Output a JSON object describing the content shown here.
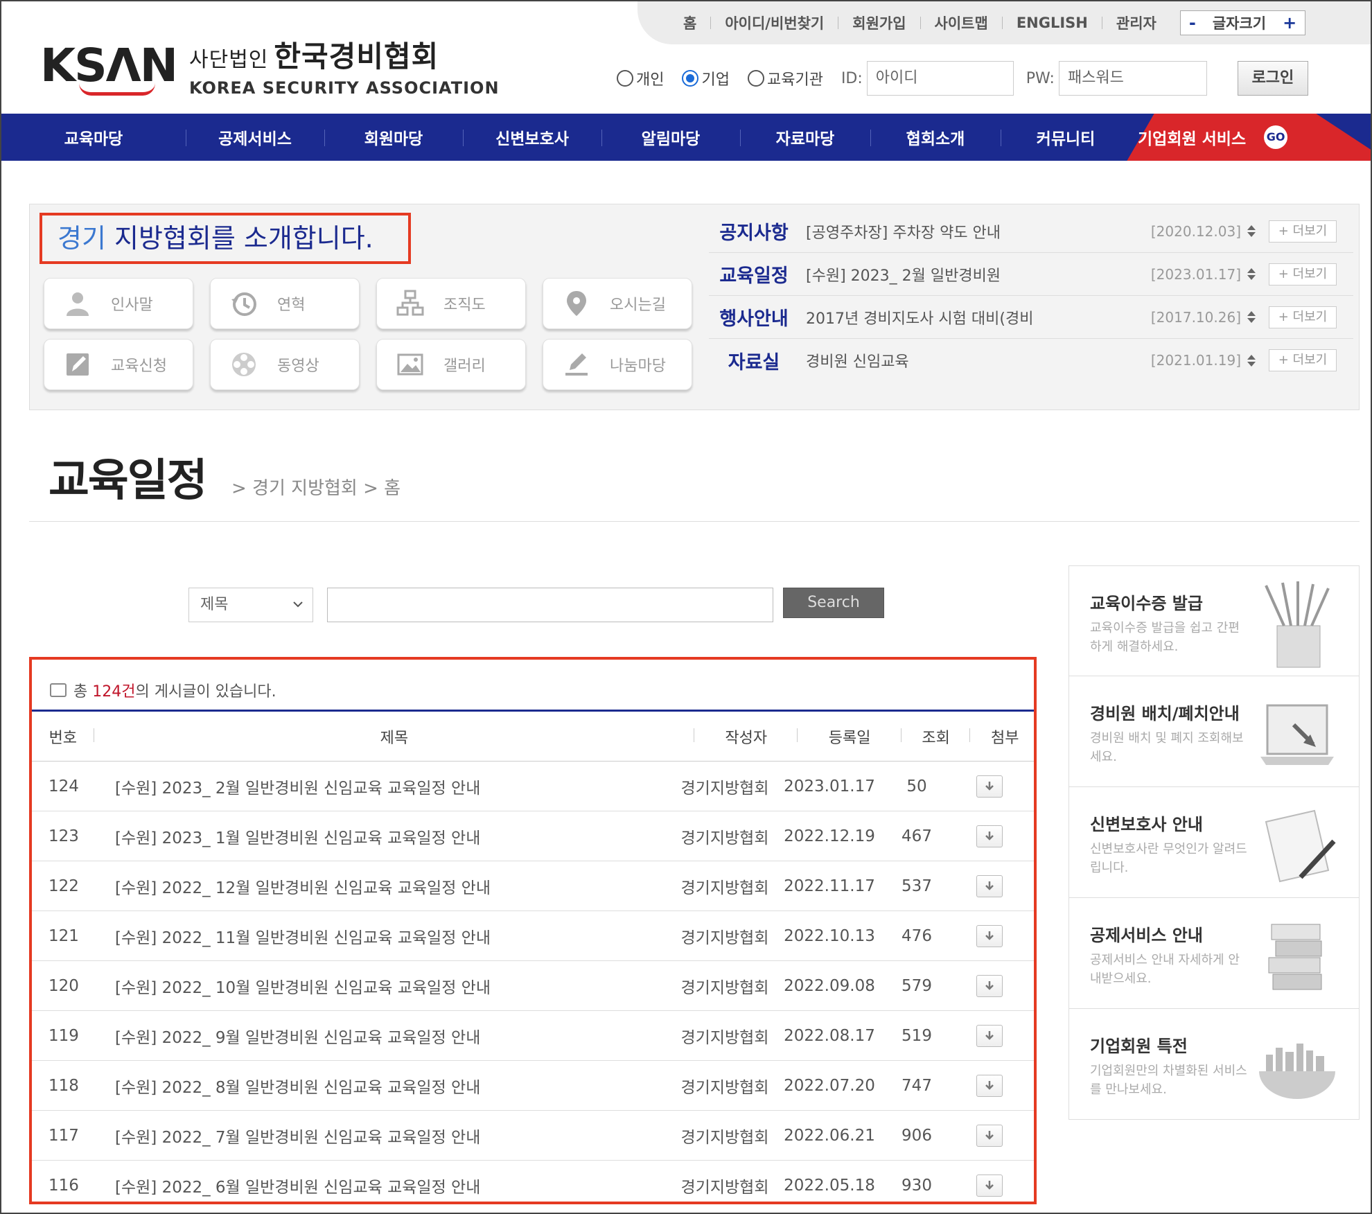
{
  "header": {
    "logo_mark": "KSΛN",
    "logo_kr_small": "사단법인",
    "logo_kr": "한국경비협회",
    "logo_en": "KOREA SECURITY ASSOCIATION"
  },
  "util_links": [
    "홈",
    "아이디/비번찾기",
    "회원가입",
    "사이트맵",
    "ENGLISH",
    "관리자"
  ],
  "font_size": {
    "minus": "-",
    "label": "글자크기",
    "plus": "+"
  },
  "login": {
    "radios": [
      {
        "label": "개인",
        "checked": false
      },
      {
        "label": "기업",
        "checked": true
      },
      {
        "label": "교육기관",
        "checked": false
      }
    ],
    "id_label": "ID:",
    "id_placeholder": "아이디",
    "pw_label": "PW:",
    "pw_placeholder": "패스워드",
    "button": "로그인"
  },
  "nav": {
    "items": [
      "교육마당",
      "공제서비스",
      "회원마당",
      "신변보호사",
      "알림마당",
      "자료마당",
      "협회소개",
      "커뮤니티"
    ],
    "corp_label": "기업회원 서비스",
    "go_label": "GO"
  },
  "intro": {
    "title_accent": "경기",
    "title_rest": " 지방협회를 소개합니다.",
    "tiles": [
      {
        "label": "인사말",
        "icon": "person-icon"
      },
      {
        "label": "연혁",
        "icon": "history-icon"
      },
      {
        "label": "조직도",
        "icon": "org-chart-icon"
      },
      {
        "label": "오시는길",
        "icon": "location-pin-icon"
      },
      {
        "label": "교육신청",
        "icon": "edit-note-icon"
      },
      {
        "label": "동영상",
        "icon": "film-reel-icon"
      },
      {
        "label": "갤러리",
        "icon": "image-icon"
      },
      {
        "label": "나눔마당",
        "icon": "pen-write-icon"
      }
    ]
  },
  "notices": [
    {
      "category": "공지사항",
      "title": "[공영주차장] 주차장 약도 안내",
      "date": "[2020.12.03]",
      "more": "+ 더보기"
    },
    {
      "category": "교육일정",
      "title": "[수원] 2023_ 2월 일반경비원",
      "date": "[2023.01.17]",
      "more": "+ 더보기"
    },
    {
      "category": "행사안내",
      "title": "2017년 경비지도사 시험 대비(경비",
      "date": "[2017.10.26]",
      "more": "+ 더보기"
    },
    {
      "category": "자료실",
      "title": "경비원 신임교육",
      "date": "[2021.01.19]",
      "more": "+ 더보기"
    }
  ],
  "page": {
    "title": "교육일정",
    "breadcrumb": "> 경기 지방협회 > 홈"
  },
  "search": {
    "select_value": "제목",
    "button": "Search"
  },
  "board": {
    "count_prefix": "총 ",
    "count_value": "124건",
    "count_suffix": "의 게시글이 있습니다.",
    "columns": [
      "번호",
      "제목",
      "작성자",
      "등록일",
      "조회",
      "첨부"
    ],
    "rows": [
      {
        "no": "124",
        "title": "[수원] 2023_ 2월 일반경비원 신임교육 교육일정 안내",
        "writer": "경기지방협회",
        "date": "2023.01.17",
        "views": "50"
      },
      {
        "no": "123",
        "title": "[수원] 2023_ 1월 일반경비원 신임교육 교육일정 안내",
        "writer": "경기지방협회",
        "date": "2022.12.19",
        "views": "467"
      },
      {
        "no": "122",
        "title": "[수원] 2022_ 12월 일반경비원 신임교육 교육일정 안내",
        "writer": "경기지방협회",
        "date": "2022.11.17",
        "views": "537"
      },
      {
        "no": "121",
        "title": "[수원] 2022_ 11월 일반경비원 신임교육 교육일정 안내",
        "writer": "경기지방협회",
        "date": "2022.10.13",
        "views": "476"
      },
      {
        "no": "120",
        "title": "[수원] 2022_ 10월 일반경비원 신임교육 교육일정 안내",
        "writer": "경기지방협회",
        "date": "2022.09.08",
        "views": "579"
      },
      {
        "no": "119",
        "title": "[수원] 2022_ 9월 일반경비원 신임교육 교육일정 안내",
        "writer": "경기지방협회",
        "date": "2022.08.17",
        "views": "519"
      },
      {
        "no": "118",
        "title": "[수원] 2022_ 8월 일반경비원 신임교육 교육일정 안내",
        "writer": "경기지방협회",
        "date": "2022.07.20",
        "views": "747"
      },
      {
        "no": "117",
        "title": "[수원] 2022_ 7월 일반경비원 신임교육 교육일정 안내",
        "writer": "경기지방협회",
        "date": "2022.06.21",
        "views": "906"
      },
      {
        "no": "116",
        "title": "[수원] 2022_ 6월 일반경비원 신임교육 교육일정 안내",
        "writer": "경기지방협회",
        "date": "2022.05.18",
        "views": "930"
      }
    ]
  },
  "side_banners": [
    {
      "title": "교육이수증 발급",
      "desc": "교육이수증 발급을 쉽고 간편하게 해결하세요.",
      "icon": "pencils-icon"
    },
    {
      "title": "경비원 배치/폐치안내",
      "desc": "경비원 배치 및 폐지 조회해보세요.",
      "icon": "laptop-icon"
    },
    {
      "title": "신변보호사 안내",
      "desc": "신변보호사란 무엇인가 알려드립니다.",
      "icon": "notebook-pen-icon"
    },
    {
      "title": "공제서비스 안내",
      "desc": "공제서비스 안내 자세하게 안내받으세요.",
      "icon": "books-icon"
    },
    {
      "title": "기업회원 특전",
      "desc": "기업회원만의 차별화된 서비스를 만나보세요.",
      "icon": "city-globe-icon"
    }
  ],
  "colors": {
    "navy": "#1b2a8f",
    "red": "#d9262a",
    "highlight_border": "#e53a22"
  }
}
